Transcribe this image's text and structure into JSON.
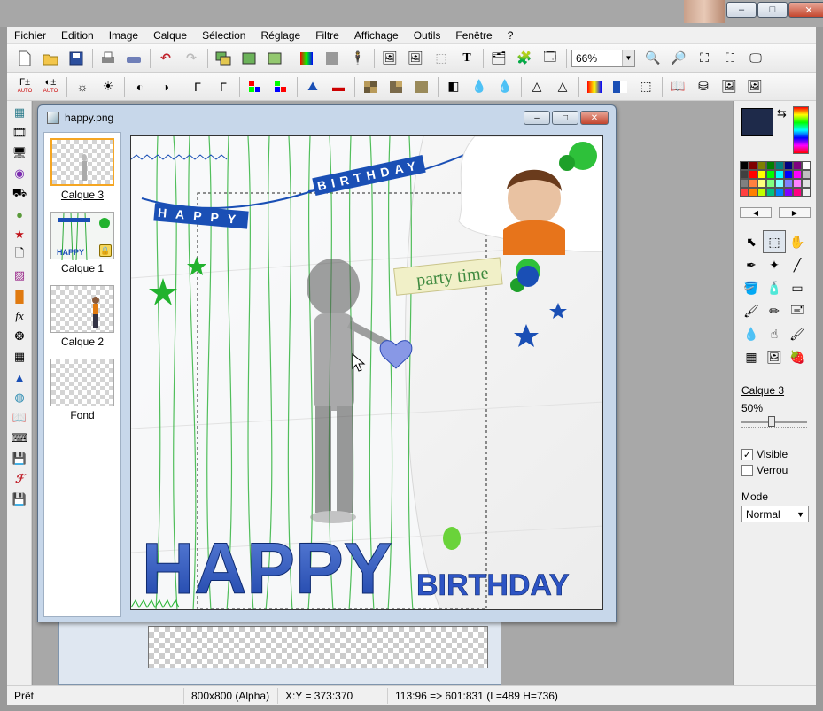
{
  "window": {
    "min": "–",
    "max": "□",
    "close": "✕"
  },
  "menu": [
    "Fichier",
    "Edition",
    "Image",
    "Calque",
    "Sélection",
    "Réglage",
    "Filtre",
    "Affichage",
    "Outils",
    "Fenêtre",
    "?"
  ],
  "zoom": {
    "value": "66%"
  },
  "toolbar2_labels": {
    "auto1": "AUTO",
    "auto2": "AUTO"
  },
  "document": {
    "title": "happy.png"
  },
  "layers": [
    {
      "name": "Calque 3",
      "selected": true
    },
    {
      "name": "Calque 1",
      "locked": true
    },
    {
      "name": "Calque 2"
    },
    {
      "name": "Fond"
    }
  ],
  "canvas_text": {
    "banner1": "HAPPY",
    "banner2": "BIRTHDAY",
    "party": "party time",
    "bottom_happy": "HAPPY",
    "bottom_birthday": "BIRTHDAY"
  },
  "colors": {
    "foreground": "#1e2a4a",
    "background": "#c8c8c8",
    "accent_blue": "#1a4fb5",
    "accent_green": "#22b22e"
  },
  "palette": [
    "#000000",
    "#7f0000",
    "#7f7f00",
    "#007f00",
    "#007f7f",
    "#00007f",
    "#7f007f",
    "#ffffff",
    "#404040",
    "#ff0000",
    "#ffff00",
    "#00ff00",
    "#00ffff",
    "#0000ff",
    "#ff00ff",
    "#c0c0c0",
    "#808080",
    "#ff8040",
    "#ffff80",
    "#80ff80",
    "#80ffff",
    "#8080ff",
    "#ff80ff",
    "#e0e0e0",
    "#ff4040",
    "#ff8000",
    "#c0ff00",
    "#00c080",
    "#0080ff",
    "#8000ff",
    "#ff0080",
    "#f0f0f0"
  ],
  "right_panel": {
    "layer_name": "Calque 3",
    "opacity": "50%",
    "visible_label": "Visible",
    "visible_checked": true,
    "lock_label": "Verrou",
    "lock_checked": false,
    "mode_label": "Mode",
    "mode_value": "Normal"
  },
  "status": {
    "ready": "Prêt",
    "dimensions": "800x800 (Alpha)",
    "coords": "X:Y = 373:370",
    "selection": "113:96 => 601:831 (L=489  H=736)"
  }
}
